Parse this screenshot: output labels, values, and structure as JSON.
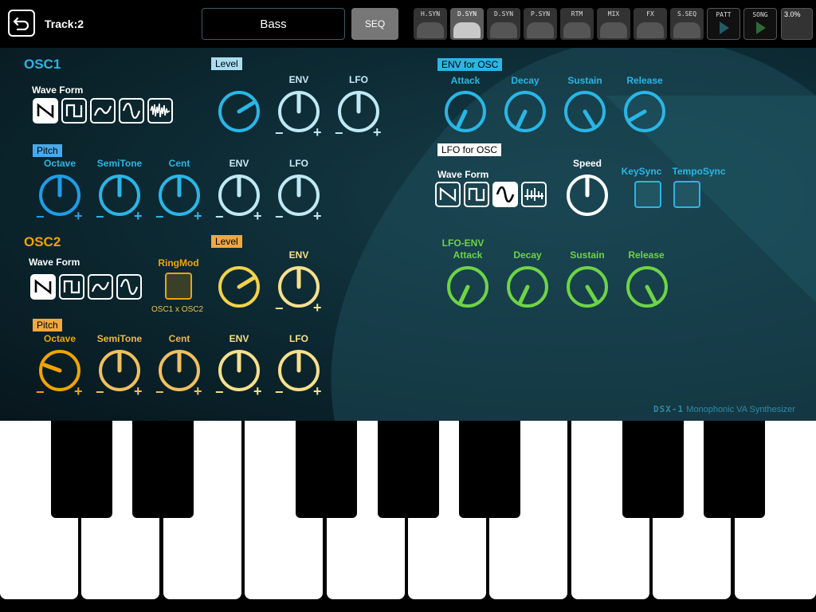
{
  "header": {
    "track": "Track:2",
    "preset": "Bass",
    "seq": "SEQ",
    "nav": [
      "H.SYN",
      "D.SYN",
      "D.SYN",
      "P.SYN",
      "RTM",
      "MIX",
      "FX",
      "S.SEQ",
      "PATT",
      "SONG"
    ],
    "active_nav": 1,
    "cpu": "3.0%"
  },
  "osc1": {
    "title": "OSC1",
    "wave_form_label": "Wave Form",
    "level_tag": "Level",
    "env_label": "ENV",
    "lfo_label": "LFO",
    "pitch_tag": "Pitch",
    "pitch_labels": [
      "Octave",
      "SemiTone",
      "Cent",
      "ENV",
      "LFO"
    ]
  },
  "osc2": {
    "title": "OSC2",
    "wave_form_label": "Wave Form",
    "ringmod_label": "RingMod",
    "ringmod_sub": "OSC1 x OSC2",
    "level_tag": "Level",
    "env_label": "ENV",
    "pitch_tag": "Pitch",
    "pitch_labels": [
      "Octave",
      "SemiTone",
      "Cent",
      "ENV",
      "LFO"
    ]
  },
  "env_osc": {
    "tag": "ENV for OSC",
    "labels": [
      "Attack",
      "Decay",
      "Sustain",
      "Release"
    ]
  },
  "lfo_osc": {
    "tag": "LFO for OSC",
    "wave_form_label": "Wave Form",
    "speed_label": "Speed",
    "keysync_label": "KeySync",
    "temposync_label": "TempoSync"
  },
  "lfo_env": {
    "title": "LFO-ENV",
    "labels": [
      "Attack",
      "Decay",
      "Sustain",
      "Release"
    ]
  },
  "brand": {
    "logo": "DSX-1",
    "text": "Monophonic VA Synthesizer"
  },
  "plus": "+",
  "minus": "−",
  "colors": {
    "cyan": "#2ab6e6",
    "pale": "#bfe9f5",
    "orange": "#f0a400",
    "yellow": "#f7dc6e",
    "green": "#6ed446",
    "panel": "#0c2831"
  }
}
